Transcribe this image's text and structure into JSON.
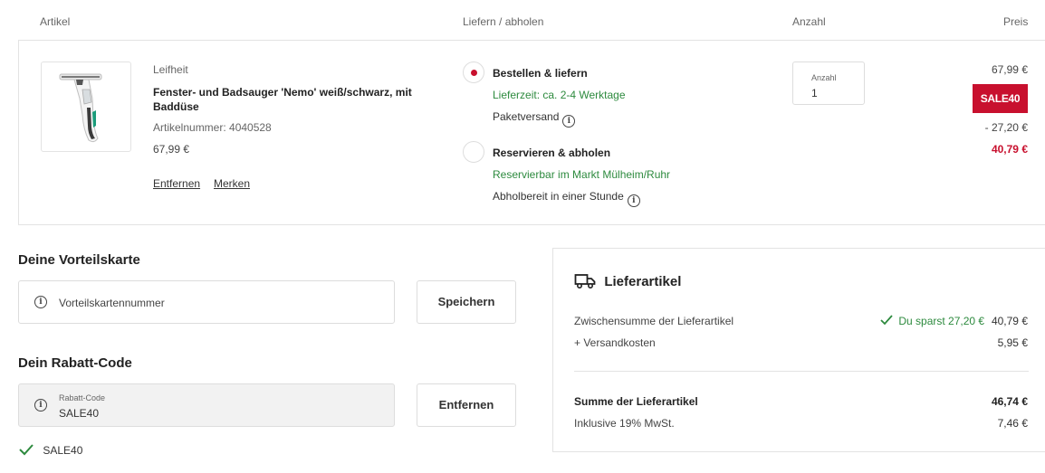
{
  "headers": {
    "article": "Artikel",
    "delivery": "Liefern / abholen",
    "quantity": "Anzahl",
    "price": "Preis"
  },
  "item": {
    "brand": "Leifheit",
    "name": "Fenster- und Badsauger 'Nemo' weiß/schwarz, mit Baddüse",
    "article_number": "Artikelnummer: 4040528",
    "unit_price": "67,99 €",
    "remove_link": "Entfernen",
    "save_link": "Merken"
  },
  "delivery": {
    "option1_title": "Bestellen & liefern",
    "option1_time": "Lieferzeit: ca. 2-4 Werktage",
    "option1_method": "Paketversand",
    "option2_title": "Reservieren & abholen",
    "option2_store": "Reservierbar im Markt Mülheim/Ruhr",
    "option2_ready": "Abholbereit in einer Stunde"
  },
  "quantity": {
    "label": "Anzahl",
    "value": "1"
  },
  "pricing": {
    "original": "67,99 €",
    "badge": "SALE40",
    "discount": "- 27,20 €",
    "final": "40,79 €"
  },
  "loyalty": {
    "heading": "Deine Vorteilskarte",
    "placeholder": "Vorteilskartennummer",
    "button": "Speichern"
  },
  "coupon": {
    "heading": "Dein Rabatt-Code",
    "label": "Rabatt-Code",
    "value": "SALE40",
    "button": "Entfernen",
    "applied": "SALE40"
  },
  "summary": {
    "title": "Lieferartikel",
    "subtotal_label": "Zwischensumme der Lieferartikel",
    "savings": "Du sparst 27,20 €",
    "subtotal_value": "40,79 €",
    "shipping_label": "+ Versandkosten",
    "shipping_value": "5,95 €",
    "total_label": "Summe der Lieferartikel",
    "total_value": "46,74 €",
    "vat_label": "Inklusive 19% MwSt.",
    "vat_value": "7,46 €"
  },
  "colors": {
    "accent_red": "#c8102e",
    "success_green": "#2d8a3e"
  },
  "icons": [
    "info-icon",
    "check-icon",
    "truck-icon",
    "radio-selected-icon"
  ]
}
